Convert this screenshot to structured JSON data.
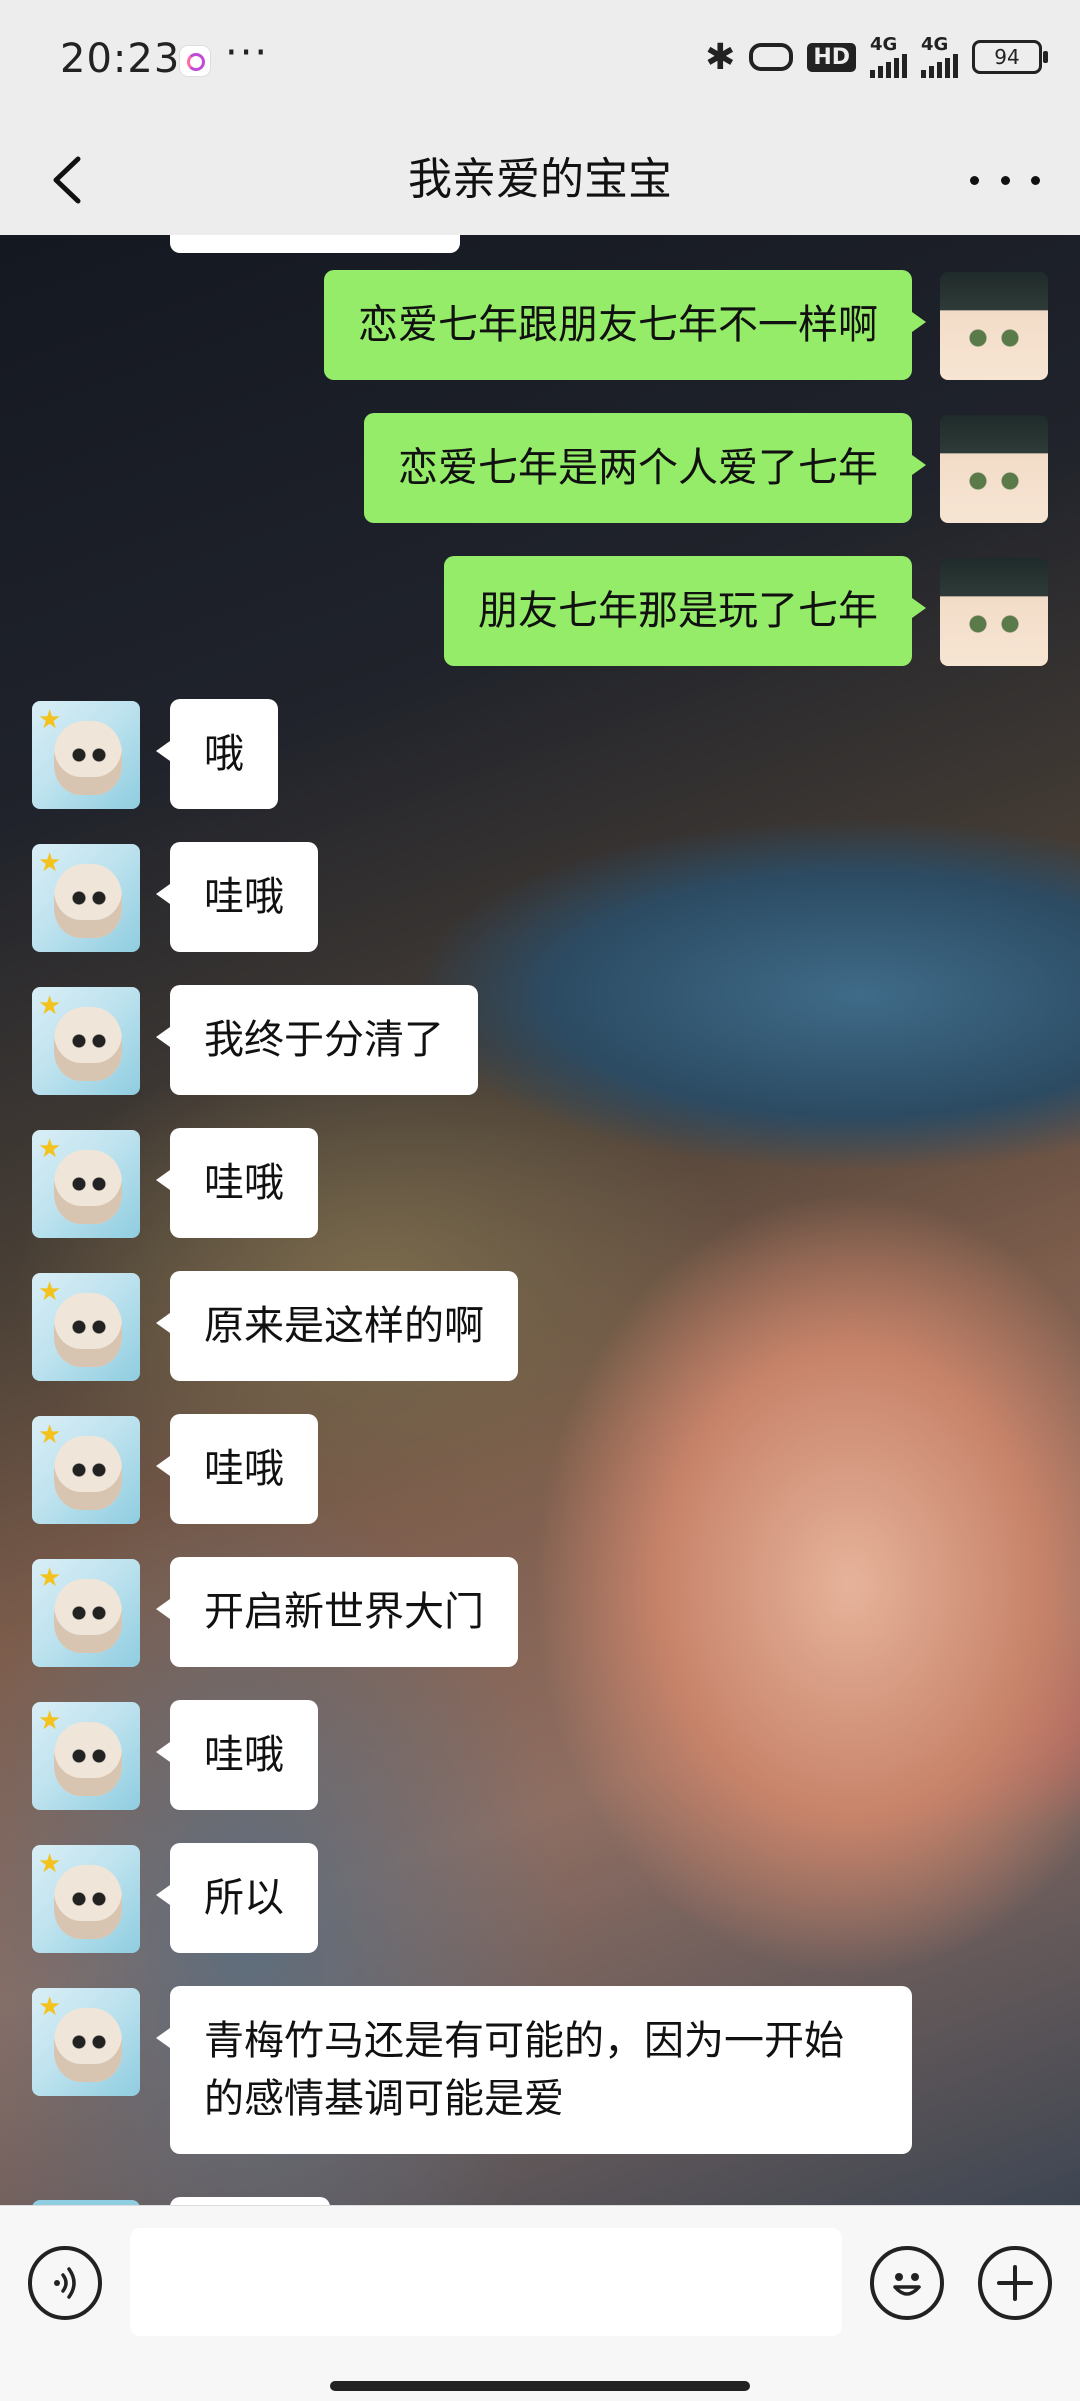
{
  "status_bar": {
    "time": "20:23",
    "more": "···",
    "hd": "HD",
    "net1": "4G",
    "net2": "4G",
    "battery": "94"
  },
  "nav": {
    "title": "我亲爱的宝宝"
  },
  "messages": [
    {
      "side": "me",
      "text": "恋爱七年跟朋友七年不一样啊"
    },
    {
      "side": "me",
      "text": "恋爱七年是两个人爱了七年"
    },
    {
      "side": "me",
      "text": "朋友七年那是玩了七年"
    },
    {
      "side": "them",
      "text": "哦"
    },
    {
      "side": "them",
      "text": "哇哦"
    },
    {
      "side": "them",
      "text": "我终于分清了"
    },
    {
      "side": "them",
      "text": "哇哦"
    },
    {
      "side": "them",
      "text": "原来是这样的啊"
    },
    {
      "side": "them",
      "text": "哇哦"
    },
    {
      "side": "them",
      "text": "开启新世界大门"
    },
    {
      "side": "them",
      "text": "哇哦"
    },
    {
      "side": "them",
      "text": "所以"
    },
    {
      "side": "them",
      "text": "青梅竹马还是有可能的，因为一开始的感情基调可能是爱"
    }
  ],
  "input": {
    "placeholder": ""
  },
  "icons": {
    "back": "chevron-left-icon",
    "more": "more-dots-icon",
    "voice": "voice-icon",
    "emoji": "emoji-icon",
    "plus": "plus-icon"
  }
}
